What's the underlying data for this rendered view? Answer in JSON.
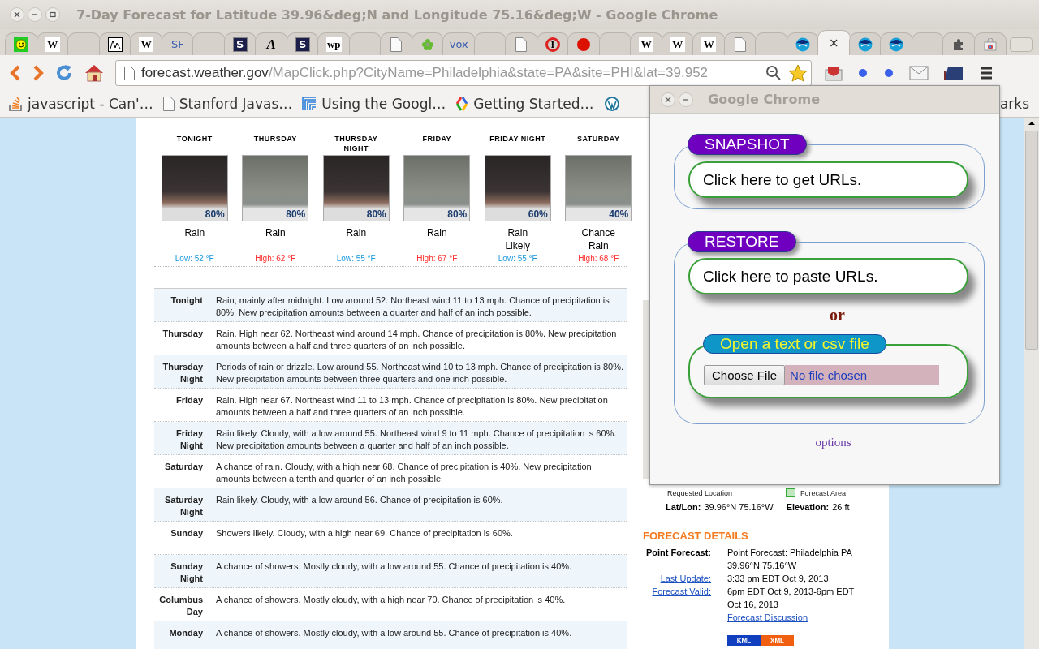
{
  "window": {
    "title": "7-Day Forecast for Latitude 39.96&deg;N and Longitude 75.16&deg;W - Google Chrome"
  },
  "tabs": [
    {
      "kind": "smiley",
      "selected": false
    },
    {
      "kind": "wiki",
      "glyph": "W",
      "selected": false
    },
    {
      "kind": "none",
      "selected": false
    },
    {
      "kind": "chart",
      "selected": false
    },
    {
      "kind": "wiki",
      "glyph": "W",
      "selected": false
    },
    {
      "kind": "plain",
      "glyph": "SF",
      "selected": false
    },
    {
      "kind": "none",
      "selected": false
    },
    {
      "kind": "badge",
      "glyph": "S",
      "selected": false
    },
    {
      "kind": "italic",
      "glyph": "A",
      "selected": false
    },
    {
      "kind": "badge",
      "glyph": "S",
      "selected": false
    },
    {
      "kind": "wiki",
      "glyph": "wp",
      "selected": false
    },
    {
      "kind": "none",
      "selected": false
    },
    {
      "kind": "doc",
      "selected": false
    },
    {
      "kind": "flower",
      "selected": false
    },
    {
      "kind": "plain",
      "glyph": "vox",
      "selected": false
    },
    {
      "kind": "none",
      "selected": false
    },
    {
      "kind": "doc",
      "selected": false
    },
    {
      "kind": "ring",
      "glyph": "I",
      "selected": false
    },
    {
      "kind": "ball",
      "selected": false
    },
    {
      "kind": "none",
      "selected": false
    },
    {
      "kind": "wiki",
      "glyph": "W",
      "selected": false
    },
    {
      "kind": "wiki",
      "glyph": "W",
      "selected": false
    },
    {
      "kind": "wiki",
      "glyph": "W",
      "selected": false
    },
    {
      "kind": "doc",
      "selected": false
    },
    {
      "kind": "none",
      "selected": false
    },
    {
      "kind": "noaa",
      "selected": false
    },
    {
      "kind": "close",
      "glyph": "×",
      "selected": true
    },
    {
      "kind": "noaa",
      "selected": false
    },
    {
      "kind": "noaa",
      "selected": false
    },
    {
      "kind": "none",
      "selected": false
    },
    {
      "kind": "puzzle",
      "selected": false
    },
    {
      "kind": "store",
      "selected": false
    }
  ],
  "toolbar": {
    "url_host": "forecast.weather.gov",
    "url_path": "/MapClick.php?CityName=Philadelphia&state=PA&site=PHI&lat=39.952",
    "starred": true
  },
  "bookmarks": [
    {
      "kind": "stack",
      "label": "javascript - Can'…"
    },
    {
      "kind": "doc",
      "label": "Stanford Javas…"
    },
    {
      "kind": "lines",
      "label": "Using the Googl…"
    },
    {
      "kind": "brackets",
      "label": "Getting Started…"
    },
    {
      "kind": "wordpress"
    }
  ],
  "bookmarks_tail": "arks",
  "forecast_periods": [
    {
      "name": "TONIGHT",
      "chance": "80%",
      "summary": "Rain",
      "temp": "Low: 52 °F",
      "kind": "low"
    },
    {
      "name": "THURSDAY",
      "chance": "80%",
      "summary": "Rain",
      "temp": "High: 62 °F",
      "kind": "high"
    },
    {
      "name": "THURSDAY NIGHT",
      "chance": "80%",
      "summary": "Rain",
      "temp": "Low: 55 °F",
      "kind": "low"
    },
    {
      "name": "FRIDAY",
      "chance": "80%",
      "summary": "Rain",
      "temp": "High: 67 °F",
      "kind": "high"
    },
    {
      "name": "FRIDAY NIGHT",
      "chance": "60%",
      "summary": "Rain Likely",
      "temp": "Low: 55 °F",
      "kind": "low"
    },
    {
      "name": "SATURDAY",
      "chance": "40%",
      "summary": "Chance Rain",
      "temp": "High: 68 °F",
      "kind": "high"
    }
  ],
  "detailed_forecast": [
    {
      "period": "Tonight",
      "text": "Rain, mainly after midnight. Low around 52. Northeast wind 11 to 13 mph. Chance of precipitation is 80%. New precipitation amounts between a quarter and half of an inch possible."
    },
    {
      "period": "Thursday",
      "text": "Rain. High near 62. Northeast wind around 14 mph. Chance of precipitation is 80%. New precipitation amounts between a half and three quarters of an inch possible."
    },
    {
      "period": "Thursday Night",
      "text": "Periods of rain or drizzle. Low around 55. Northeast wind 10 to 13 mph. Chance of precipitation is 80%. New precipitation amounts between three quarters and one inch possible."
    },
    {
      "period": "Friday",
      "text": "Rain. High near 67. Northeast wind 11 to 13 mph. Chance of precipitation is 80%. New precipitation amounts between a half and three quarters of an inch possible."
    },
    {
      "period": "Friday Night",
      "text": "Rain likely. Cloudy, with a low around 55. Northeast wind 9 to 11 mph. Chance of precipitation is 60%. New precipitation amounts between a quarter and half of an inch possible."
    },
    {
      "period": "Saturday",
      "text": "A chance of rain. Cloudy, with a high near 68. Chance of precipitation is 40%. New precipitation amounts between a tenth and quarter of an inch possible."
    },
    {
      "period": "Saturday Night",
      "text": "Rain likely. Cloudy, with a low around 56. Chance of precipitation is 60%."
    },
    {
      "period": "Sunday",
      "text": "Showers likely. Cloudy, with a high near 69. Chance of precipitation is 60%."
    },
    {
      "period": "Sunday Night",
      "text": "A chance of showers. Mostly cloudy, with a low around 55. Chance of precipitation is 40%."
    },
    {
      "period": "Columbus Day",
      "text": "A chance of showers. Mostly cloudy, with a high near 70. Chance of precipitation is 40%."
    },
    {
      "period": "Monday",
      "text": "A chance of showers. Mostly cloudy, with a low around 55. Chance of precipitation is 40%."
    }
  ],
  "location": {
    "legend": [
      "Requested Location",
      "Forecast Area"
    ],
    "latlon_label": "Lat/Lon:",
    "latlon": "39.96°N 75.16°W",
    "elevation_label": "Elevation:",
    "elevation": "26 ft"
  },
  "forecast_details": {
    "heading": "FORECAST DETAILS",
    "rows": [
      {
        "label": "Point Forecast:",
        "link": false,
        "lines": [
          "Point Forecast: Philadelphia PA",
          "39.96°N 75.16°W"
        ]
      },
      {
        "label": "Last Update:",
        "link": true,
        "lines": [
          "3:33 pm EDT Oct 9, 2013"
        ]
      },
      {
        "label": "Forecast Valid:",
        "link": true,
        "lines": [
          "6pm EDT Oct 9, 2013-6pm EDT Oct 16, 2013"
        ]
      }
    ],
    "discussion_link": "Forecast Discussion",
    "formats": [
      "KML",
      "XML"
    ]
  },
  "popup": {
    "title": "Google Chrome",
    "snapshot": {
      "legend": "SNAPSHOT",
      "button": "Click here to get URLs."
    },
    "restore": {
      "legend": "RESTORE",
      "button": "Click here to paste URLs.",
      "separator": "or",
      "file_legend": "Open a text or csv file",
      "file_button": "Choose File",
      "file_status": "No file chosen"
    },
    "options_link": "options"
  }
}
